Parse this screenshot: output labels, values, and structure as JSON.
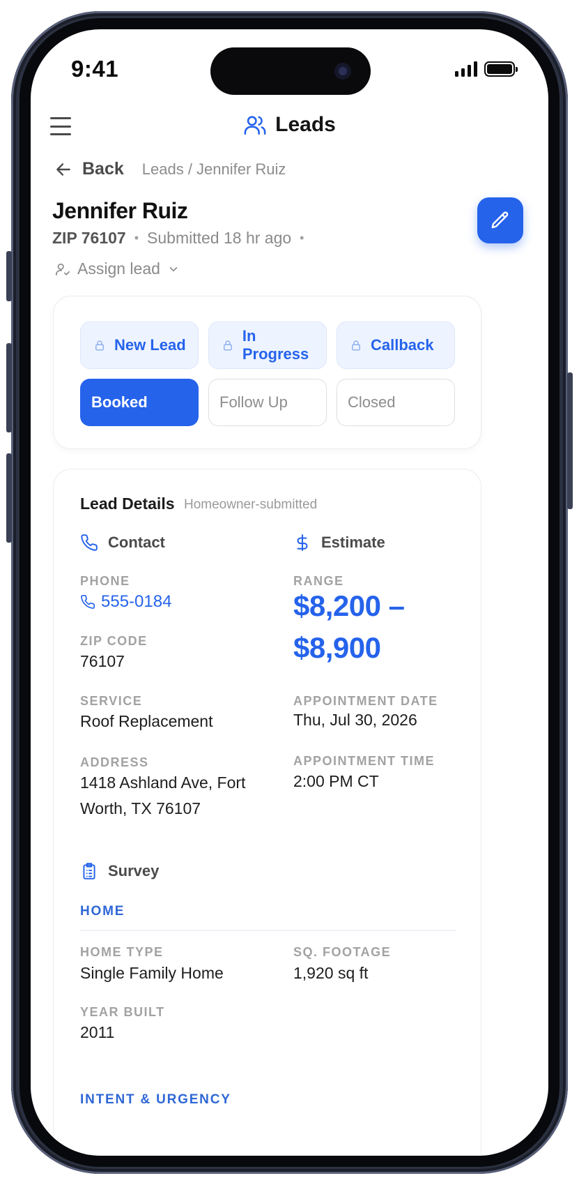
{
  "status_bar": {
    "time": "9:41"
  },
  "header": {
    "title": "Leads",
    "menu_icon": "hamburger-icon",
    "title_icon": "users-icon"
  },
  "nav": {
    "back_label": "Back",
    "breadcrumb": "Leads / Jennifer Ruiz"
  },
  "lead": {
    "name": "Jennifer Ruiz",
    "zip_label": "ZIP 76107",
    "submitted": "Submitted 18 hr ago",
    "assign_label": "Assign lead"
  },
  "statuses": [
    {
      "label": "New Lead",
      "state": "locked"
    },
    {
      "label": "In Progress",
      "state": "locked"
    },
    {
      "label": "Callback",
      "state": "locked"
    },
    {
      "label": "Booked",
      "state": "active"
    },
    {
      "label": "Follow Up",
      "state": "available"
    },
    {
      "label": "Closed",
      "state": "available"
    }
  ],
  "details": {
    "title": "Lead Details",
    "subtitle": "Homeowner-submitted",
    "contact": {
      "heading": "Contact",
      "phone_label": "PHONE",
      "phone": "555-0184",
      "zip_label": "ZIP CODE",
      "zip": "76107",
      "service_label": "SERVICE",
      "service": "Roof Replacement",
      "address_label": "ADDRESS",
      "address_line1": "1418 Ashland Ave, Fort",
      "address_line2": "Worth, TX 76107"
    },
    "estimate": {
      "heading": "Estimate",
      "range_label": "RANGE",
      "range_line1": "$8,200 –",
      "range_line2": "$8,900",
      "appt_date_label": "APPOINTMENT DATE",
      "appt_date": "Thu, Jul 30, 2026",
      "appt_time_label": "APPOINTMENT TIME",
      "appt_time": "2:00 PM CT"
    },
    "survey": {
      "heading": "Survey",
      "section": "HOME",
      "home_type_label": "HOME TYPE",
      "home_type": "Single Family Home",
      "sqft_label": "SQ. FOOTAGE",
      "sqft": "1,920 sq ft",
      "year_label": "YEAR BUILT",
      "year": "2011",
      "next_section": "INTENT & URGENCY"
    }
  },
  "colors": {
    "accent": "#2563eb",
    "muted": "#8a8a8a",
    "frame": "#2b3140"
  }
}
